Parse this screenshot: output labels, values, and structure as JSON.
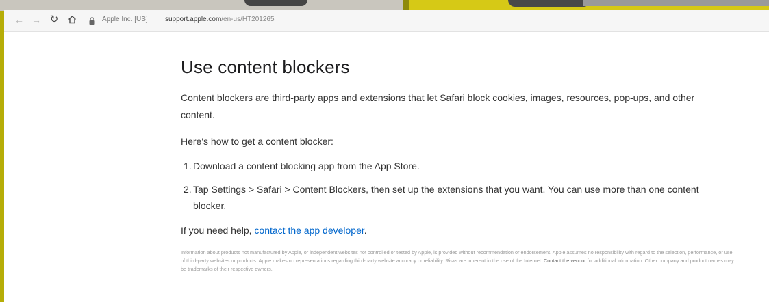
{
  "browser": {
    "site_owner": "Apple Inc. [US]",
    "separator": "|",
    "url_domain": "support.apple.com",
    "url_path": "/en-us/HT201265"
  },
  "icons": {
    "back": "back-arrow-icon",
    "forward": "forward-arrow-icon",
    "reload": "reload-icon",
    "home": "home-icon",
    "lock": "lock-icon"
  },
  "article": {
    "title": "Use content blockers",
    "intro": "Content blockers are third-party apps and extensions that let Safari block cookies, images, resources, pop-ups, and other content.",
    "howto": "Here's how to get a content blocker:",
    "steps": [
      {
        "num": "1.",
        "text": "Download a content blocking app from the App Store."
      },
      {
        "num": "2.",
        "text": "Tap Settings > Safari > Content Blockers, then set up the extensions that you want. You can use more than one content blocker."
      }
    ],
    "help_prefix": "If you need help, ",
    "help_link": "contact the app developer",
    "help_suffix": "."
  },
  "disclaimer": {
    "text_before": "Information about products not manufactured by Apple, or independent websites not controlled or tested by Apple, is provided without recommendation or endorsement. Apple assumes no responsibility with regard to the selection, performance, or use of third-party websites or products. Apple makes no representations regarding third-party website accuracy or reliability. Risks are inherent in the use of the Internet. ",
    "vendor_link": "Contact the vendor",
    "text_after": " for additional information. Other company and product names may be trademarks of their respective owners."
  },
  "colors": {
    "frame": "#b6ad07",
    "link": "#0066cc",
    "text": "#333333"
  }
}
